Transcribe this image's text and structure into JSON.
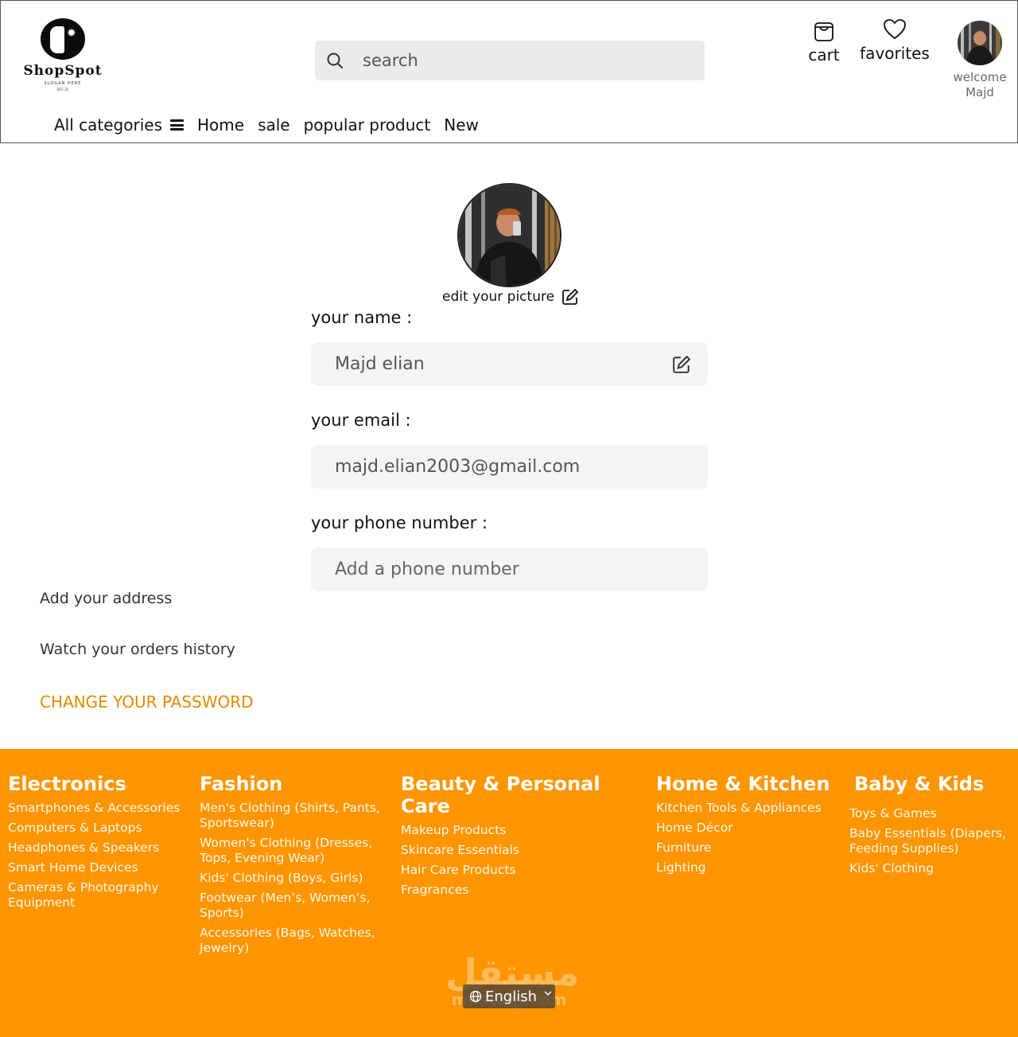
{
  "header": {
    "logo": {
      "name": "ShopSpot",
      "slogan": "SLOGAN HERE",
      "est": "EST. 21"
    },
    "search": {
      "placeholder": "search"
    },
    "cart_label": "cart",
    "favorites_label": "favorites",
    "welcome": {
      "line1": "welcome",
      "line2": "Majd"
    }
  },
  "nav": {
    "all_categories": "All categories",
    "items": [
      "Home",
      "sale",
      "popular product",
      "New"
    ]
  },
  "profile": {
    "edit_picture": "edit your picture",
    "name_label": "your name :",
    "name_value": "Majd elian",
    "email_label": "your email :",
    "email_value": "majd.elian2003@gmail.com",
    "phone_label": "your phone number :",
    "phone_placeholder": "Add a phone number"
  },
  "side_links": {
    "address": "Add your address",
    "orders": "Watch your orders history",
    "password": "CHANGE YOUR PASSWORD"
  },
  "footer": {
    "columns": [
      {
        "title": "Electronics",
        "items": [
          "Smartphones & Accessories",
          "Computers & Laptops",
          "Headphones & Speakers",
          "Smart Home Devices",
          "Cameras & Photography Equipment"
        ]
      },
      {
        "title": "Fashion",
        "items": [
          "Men's Clothing (Shirts, Pants, Sportswear)",
          "Women's Clothing (Dresses, Tops, Evening Wear)",
          "Kids' Clothing (Boys, Girls)",
          "Footwear (Men’s, Women’s, Sports)",
          "Accessories (Bags, Watches, Jewelry)"
        ]
      },
      {
        "title": "Beauty & Personal Care",
        "items": [
          "Makeup Products",
          "Skincare Essentials",
          "Hair Care Products",
          "Fragrances"
        ]
      },
      {
        "title": "Home & Kitchen",
        "items": [
          "Kitchen Tools & Appliances",
          "Home Décor",
          "Furniture",
          "Lighting"
        ]
      },
      {
        "title": "Baby & Kids",
        "items": [
          "Toys & Games",
          "Baby Essentials (Diapers, Feeding Supplies)",
          "Kids' Clothing"
        ]
      }
    ],
    "language": "English"
  },
  "colors": {
    "accent": "#ff9500",
    "password_link": "#e48a00",
    "field_bg": "#f4f4f4"
  }
}
